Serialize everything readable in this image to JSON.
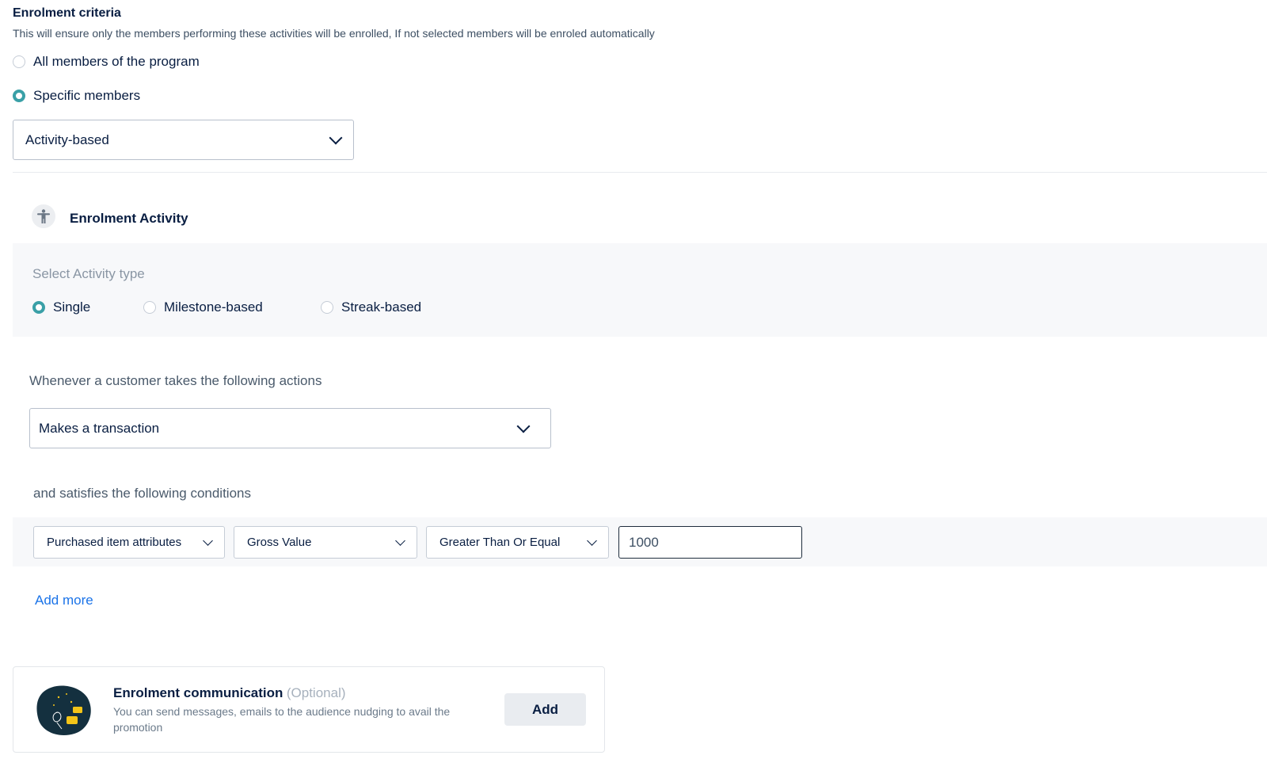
{
  "header": {
    "title": "Enrolment criteria",
    "subtitle": "This will ensure only the members performing these activities will be enrolled, If not selected members will be enroled automatically"
  },
  "membership": {
    "options": [
      {
        "label": "All members of the program",
        "checked": false
      },
      {
        "label": "Specific members",
        "checked": true
      }
    ],
    "criteria_select": "Activity-based"
  },
  "enrolment_activity": {
    "title": "Enrolment Activity",
    "type_label": "Select Activity type",
    "types": [
      {
        "label": "Single",
        "checked": true
      },
      {
        "label": "Milestone-based",
        "checked": false
      },
      {
        "label": "Streak-based",
        "checked": false
      }
    ]
  },
  "actions": {
    "label": "Whenever a customer takes the following actions",
    "select": "Makes a transaction"
  },
  "conditions": {
    "label": "and satisfies the following conditions",
    "attribute": "Purchased item attributes",
    "field": "Gross Value",
    "operator": "Greater Than Or Equal",
    "value": "1000",
    "add_more": "Add more"
  },
  "communication": {
    "title": "Enrolment communication",
    "optional": "(Optional)",
    "description": "You can send messages, emails to the audience nudging to avail the promotion",
    "add_button": "Add"
  },
  "colors": {
    "radio_checked": "#3aa0a7",
    "link": "#1a73e8",
    "illustration_bg": "#14303f",
    "illustration_accent": "#f5c518"
  }
}
